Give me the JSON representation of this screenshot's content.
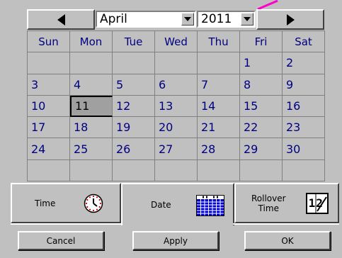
{
  "calendar": {
    "month": "April",
    "year": "2011",
    "weekdays": [
      "Sun",
      "Mon",
      "Tue",
      "Wed",
      "Thu",
      "Fri",
      "Sat"
    ],
    "weeks": [
      [
        "",
        "",
        "",
        "",
        "",
        "1",
        "2"
      ],
      [
        "3",
        "4",
        "5",
        "6",
        "7",
        "8",
        "9"
      ],
      [
        "10",
        "11",
        "12",
        "13",
        "14",
        "15",
        "16"
      ],
      [
        "17",
        "18",
        "19",
        "20",
        "21",
        "22",
        "23"
      ],
      [
        "24",
        "25",
        "26",
        "27",
        "28",
        "29",
        "30"
      ],
      [
        "",
        "",
        "",
        "",
        "",
        "",
        ""
      ]
    ],
    "selected_day": "11"
  },
  "tabs": {
    "time": "Time",
    "date": "Date",
    "rollover_line1": "Rollover",
    "rollover_line2": "Time",
    "rollover_icon_text": "12",
    "active": "date"
  },
  "buttons": {
    "cancel": "Cancel",
    "apply": "Apply",
    "ok": "OK"
  },
  "icons": {
    "prev": "left-triangle-icon",
    "next": "right-triangle-icon",
    "time_tab": "clock-icon",
    "date_tab": "calendar-icon",
    "rollover_tab": "rollover-icon"
  },
  "colors": {
    "day_text": "#000080",
    "face": "#c0c0c0",
    "selected_bg": "#a0a0a0",
    "clock_face": "#ffffff",
    "clock_ticks": "#cc0000",
    "calendar_icon": "#0000cc",
    "accent_mark": "#ff00cc"
  }
}
